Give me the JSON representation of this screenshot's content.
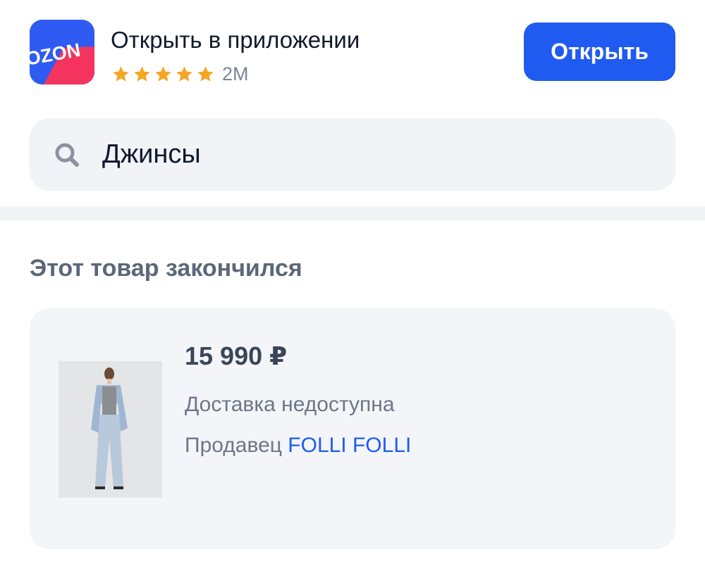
{
  "app_banner": {
    "logo_text": "OZON",
    "title": "Открыть в приложении",
    "rating_stars": 5,
    "rating_count": "2M",
    "open_button_label": "Открыть",
    "star_color": "#f5a623",
    "accent_color": "#1f5bf0"
  },
  "search": {
    "value": "Джинсы",
    "icon": "search-icon"
  },
  "out_of_stock": {
    "heading": "Этот товар закончился",
    "product": {
      "price": "15 990 ₽",
      "delivery_status": "Доставка недоступна",
      "seller_label": "Продавец",
      "seller_name": "FOLLI FOLLI"
    }
  }
}
